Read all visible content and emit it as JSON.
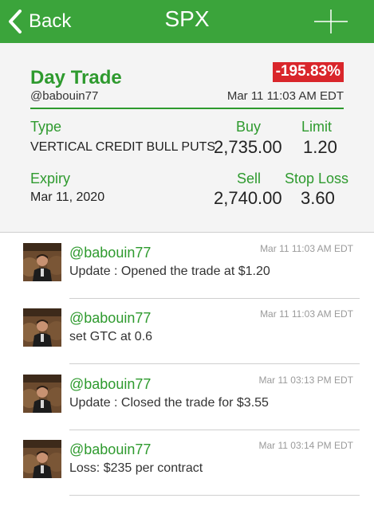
{
  "navbar": {
    "back_label": "Back",
    "title": "SPX",
    "icons": {
      "back": "chevron-left-icon",
      "add": "plus-icon"
    }
  },
  "trade": {
    "strategy": "Day Trade",
    "percent_change": "-195.83%",
    "user": "@babouin77",
    "time": "Mar 11 11:03 AM EDT",
    "type_label": "Type",
    "type_value": "VERTICAL CREDIT BULL PUTS",
    "expiry_label": "Expiry",
    "expiry_value": "Mar 11, 2020",
    "buy_label": "Buy",
    "buy_value": "2,735.00",
    "sell_label": "Sell",
    "sell_value": "2,740.00",
    "limit_label": "Limit",
    "limit_value": "1.20",
    "stop_loss_label": "Stop Loss",
    "stop_loss_value": "3.60"
  },
  "posts": [
    {
      "user": "@babouin77",
      "time": "Mar 11 11:03 AM EDT",
      "text": "Update : Opened the trade at $1.20"
    },
    {
      "user": "@babouin77",
      "time": "Mar 11 11:03 AM EDT",
      "text": "set GTC at 0.6"
    },
    {
      "user": "@babouin77",
      "time": "Mar 11 03:13 PM EDT",
      "text": "Update : Closed the trade for $3.55"
    },
    {
      "user": "@babouin77",
      "time": "Mar 11 03:14 PM EDT",
      "text": "Loss: $235 per contract"
    }
  ],
  "colors": {
    "brand_green": "#3ba43b",
    "label_green": "#2e9a2e",
    "loss_red": "#d9262b",
    "card_bg": "#f4f4f4"
  }
}
